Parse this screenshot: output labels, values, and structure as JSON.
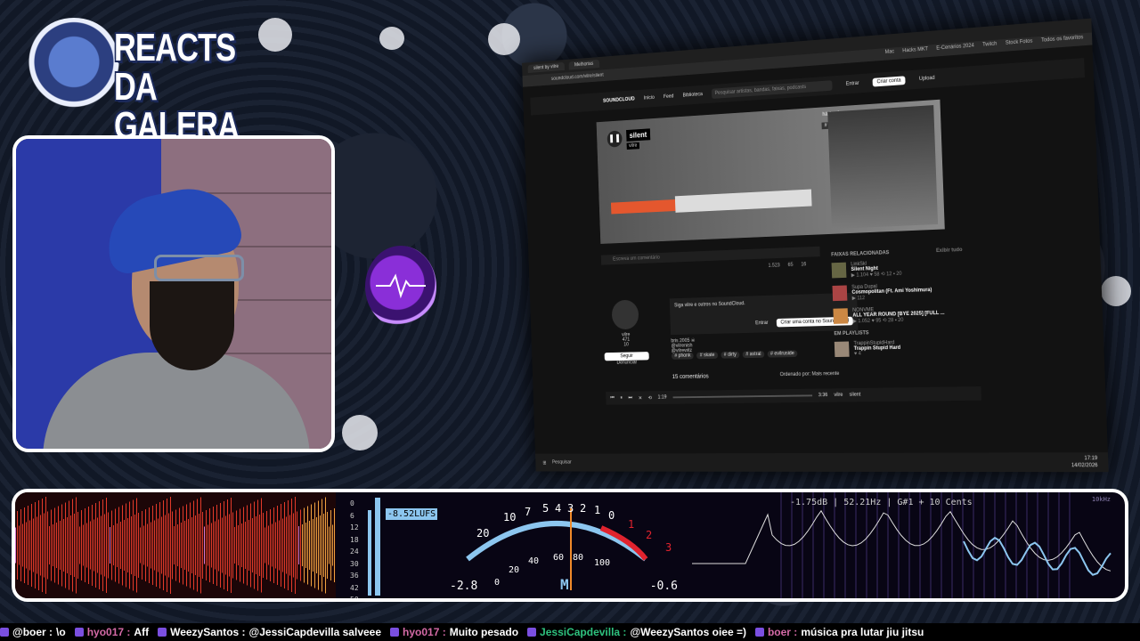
{
  "logo": {
    "line1": "REACTS",
    "line2": "DA GALERA"
  },
  "browser": {
    "tabs": [
      "silent by vilre",
      "Melhorias"
    ],
    "address": "soundcloud.com/vilre/silent",
    "bookmarks": [
      "Mac",
      "Hacks MKT",
      "E-Cenários 2024",
      "Twitch",
      "Stock Fotos",
      "Todos os favoritos"
    ],
    "nav": {
      "logo": "SOUNDCLOUD",
      "home": "Início",
      "feed": "Feed",
      "library": "Biblioteca",
      "search_placeholder": "Pesquisar artistas, bandas, faixas, podcasts",
      "signin": "Entrar",
      "create": "Criar conta",
      "upload": "Upload"
    },
    "track": {
      "title": "silent",
      "artist": "vilre",
      "time_ago": "há 1 mês",
      "tag": "# astral",
      "duration": "1:19"
    },
    "comment_placeholder": "Escreva um comentário",
    "stats": [
      "1.523",
      "65",
      "16"
    ],
    "profile": {
      "name": "vilre",
      "followers": "471",
      "tracks": "10",
      "follow": "Seguir",
      "report": "Denunciar"
    },
    "signup": {
      "text": "Siga vilre e outros no SoundCloud.",
      "signin": "Entrar",
      "create": "Criar uma conta no SoundCloud"
    },
    "description": [
      "bris 2005 ☠",
      "@vilrenish",
      "@vilrewitz"
    ],
    "tags": [
      "# phonk",
      "# skate",
      "# dirty",
      "# astral",
      "# evilruside"
    ],
    "comments_count": "15 comentários",
    "sort": "Ordenado por: Mais recente",
    "related_header": "FAIXAS RELACIONADAS",
    "related_link": "Exibir tudo",
    "related": [
      {
        "artist": "LinkSkl",
        "track": "Silent Night",
        "plays": "1.104",
        "likes": "58",
        "reposts": "12",
        "comments": "20"
      },
      {
        "artist": "Supa Dupal",
        "track": "Cosmopolitan (Ft. Ami Yoshimura)",
        "plays": "112",
        "likes": "",
        "reposts": "",
        "comments": ""
      },
      {
        "artist": "NONVME",
        "track": "ALL YEAR ROUND [BYE 2025] [FULL ...",
        "plays": "1.052",
        "likes": "95",
        "reposts": "28",
        "comments": "20"
      }
    ],
    "playlists_header": "EM PLAYLISTS",
    "playlist": {
      "artist": "TrappinStupidHard",
      "track": "Trappin Stupid Hard",
      "count": "4"
    },
    "player": {
      "elapsed": "1:19",
      "total": "3:36",
      "artist": "vilre",
      "track": "silent"
    },
    "taskbar": {
      "search": "Pesquisar",
      "time": "17:19",
      "date": "14/02/2026"
    }
  },
  "viz": {
    "lufs": "-8.52LUFS",
    "db_scale": [
      "0",
      "6",
      "12",
      "18",
      "24",
      "30",
      "36",
      "42",
      "50"
    ],
    "vu_scale_top": [
      "20",
      "10",
      "7",
      "5",
      "4",
      "3",
      "2",
      "1",
      "0",
      "1",
      "2",
      "3"
    ],
    "vu_scale_bottom": [
      "0",
      "20",
      "40",
      "60",
      "80",
      "100"
    ],
    "vu_left": "-2.8",
    "vu_right": "-0.6",
    "vu_label": "M",
    "spectrum_info": "-1.75dB | 52.21Hz | G#1 + 10 Cents",
    "spectrum_label": "10kHz"
  },
  "ticker": [
    {
      "user": "@boer",
      "msg": "\\o",
      "color": "#ffffff"
    },
    {
      "user": "hyo017",
      "msg": "Aff",
      "color": "#d46aa6"
    },
    {
      "user": "WeezySantos",
      "msg": "@JessiCapdevilla salveee",
      "color": "#ffffff"
    },
    {
      "user": "hyo017",
      "msg": "Muito pesado",
      "color": "#d46aa6"
    },
    {
      "user": "JessiCapdevilla",
      "msg": "@WeezySantos oiee =)",
      "color": "#2ec27e"
    },
    {
      "user": "boer",
      "msg": "música pra lutar jiu jitsu",
      "color": "#d46aa6"
    }
  ]
}
